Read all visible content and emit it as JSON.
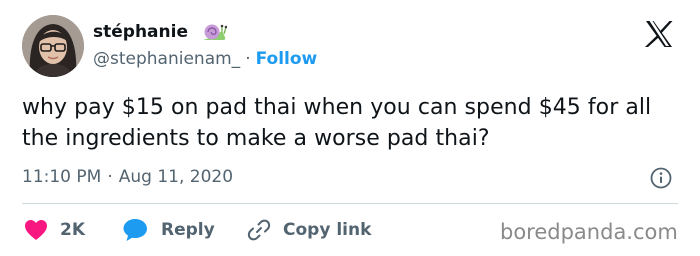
{
  "user": {
    "display_name": "stéphanie",
    "handle": "@stephanienam_",
    "separator": "·",
    "follow_label": "Follow",
    "name_emoji": "snail-icon"
  },
  "tweet": {
    "text": "why pay $15 on pad thai when you can spend $45 for all the ingredients to make a worse pad thai?",
    "time": "11:10 PM",
    "separator": "·",
    "date": "Aug 11, 2020"
  },
  "actions": {
    "like_count": "2K",
    "reply_label": "Reply",
    "copy_link_label": "Copy link"
  },
  "watermark": "boredpanda.com",
  "colors": {
    "accent": "#1d9bf0",
    "like": "#f91880",
    "text": "#0f1419",
    "secondary": "#536471",
    "divider": "#cfd9de"
  }
}
